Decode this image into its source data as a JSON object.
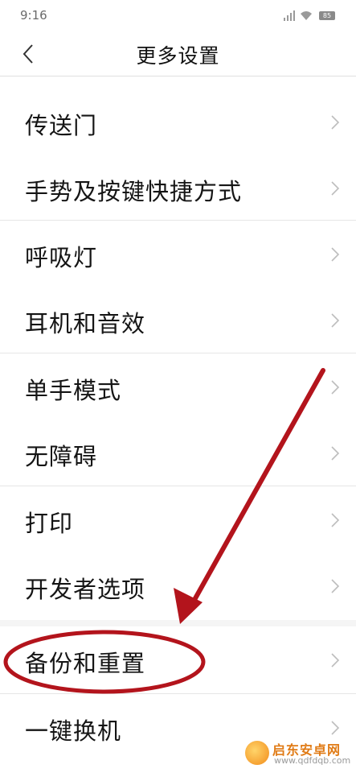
{
  "status_bar": {
    "time": "9:16",
    "battery": "85"
  },
  "header": {
    "title": "更多设置",
    "back_icon": "chevron-left-icon"
  },
  "items": [
    {
      "label": "传送门"
    },
    {
      "label": "手势及按键快捷方式"
    },
    {
      "label": "呼吸灯"
    },
    {
      "label": "耳机和音效"
    },
    {
      "label": "单手模式"
    },
    {
      "label": "无障碍"
    },
    {
      "label": "打印"
    },
    {
      "label": "开发者选项"
    },
    {
      "label": "备份和重置"
    },
    {
      "label": "一键换机"
    }
  ],
  "annotation": {
    "color": "#b3141c"
  },
  "watermark": {
    "brand": "启东安卓网",
    "url": "www.qdfdqb.com"
  }
}
